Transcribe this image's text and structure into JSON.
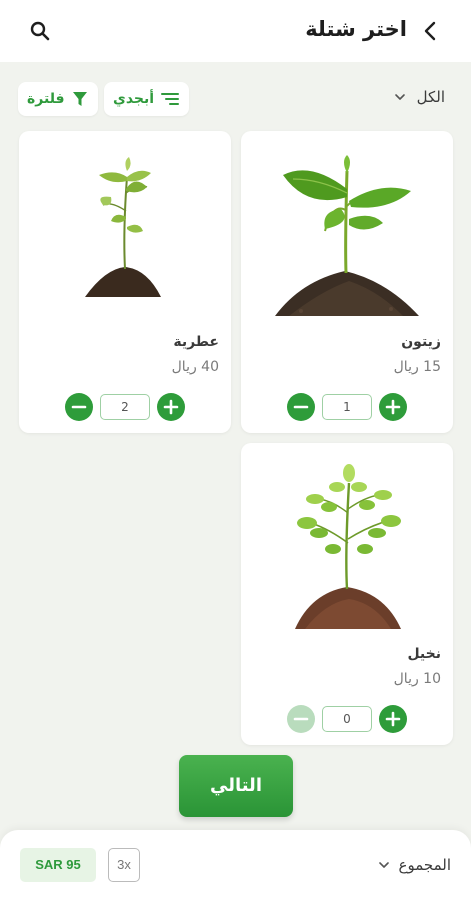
{
  "header": {
    "title": "اختر شتلة",
    "back_icon": "chevron-left-icon",
    "search_icon": "search-icon"
  },
  "filters": {
    "category": "الكل",
    "sort_label": "أبجدي",
    "filter_label": "فلترة"
  },
  "products": [
    {
      "name": "زيتون",
      "price": "15 ريال",
      "quantity": "1",
      "minus_enabled": true
    },
    {
      "name": "عطرية",
      "price": "40 ريال",
      "quantity": "2",
      "minus_enabled": true
    },
    {
      "name": "نخيل",
      "price": "10 ريال",
      "quantity": "0",
      "minus_enabled": false
    }
  ],
  "actions": {
    "next_label": "التالي"
  },
  "footer": {
    "total_label": "المجموع",
    "total_amount": "SAR 95",
    "item_count": "3x"
  },
  "colors": {
    "accent": "#2e9c3a",
    "accent_light": "#e7f4e5",
    "background": "#f1f3ee"
  }
}
